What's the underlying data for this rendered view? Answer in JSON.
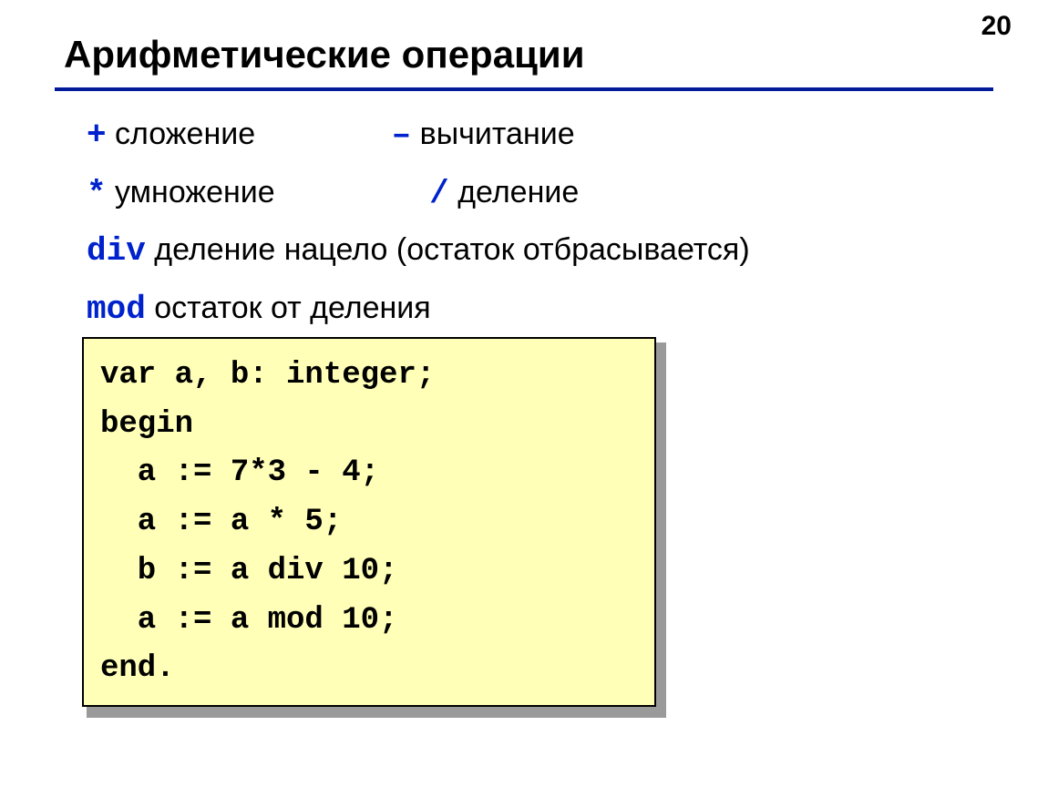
{
  "page_number": "20",
  "title": "Арифметические операции",
  "ops": {
    "plus_sym": "+",
    "plus_txt": " сложение",
    "minus_sym": "–",
    "minus_txt": " вычитание",
    "mul_sym": "*",
    "mul_txt": " умножение",
    "div_sym": "/",
    "div_txt": " деление",
    "divkw_sym": "div",
    "divkw_txt": " деление нацело (остаток отбрасывается)",
    "mod_sym": "mod",
    "mod_txt": " остаток от деления"
  },
  "code": {
    "l1": "var a, b: integer;",
    "l2": "begin",
    "l3": "  a := 7*3 - 4;",
    "l4": "  a := a * 5;",
    "l5": "  b := a div 10;",
    "l6": "  a := a mod 10;",
    "l7": "end."
  }
}
